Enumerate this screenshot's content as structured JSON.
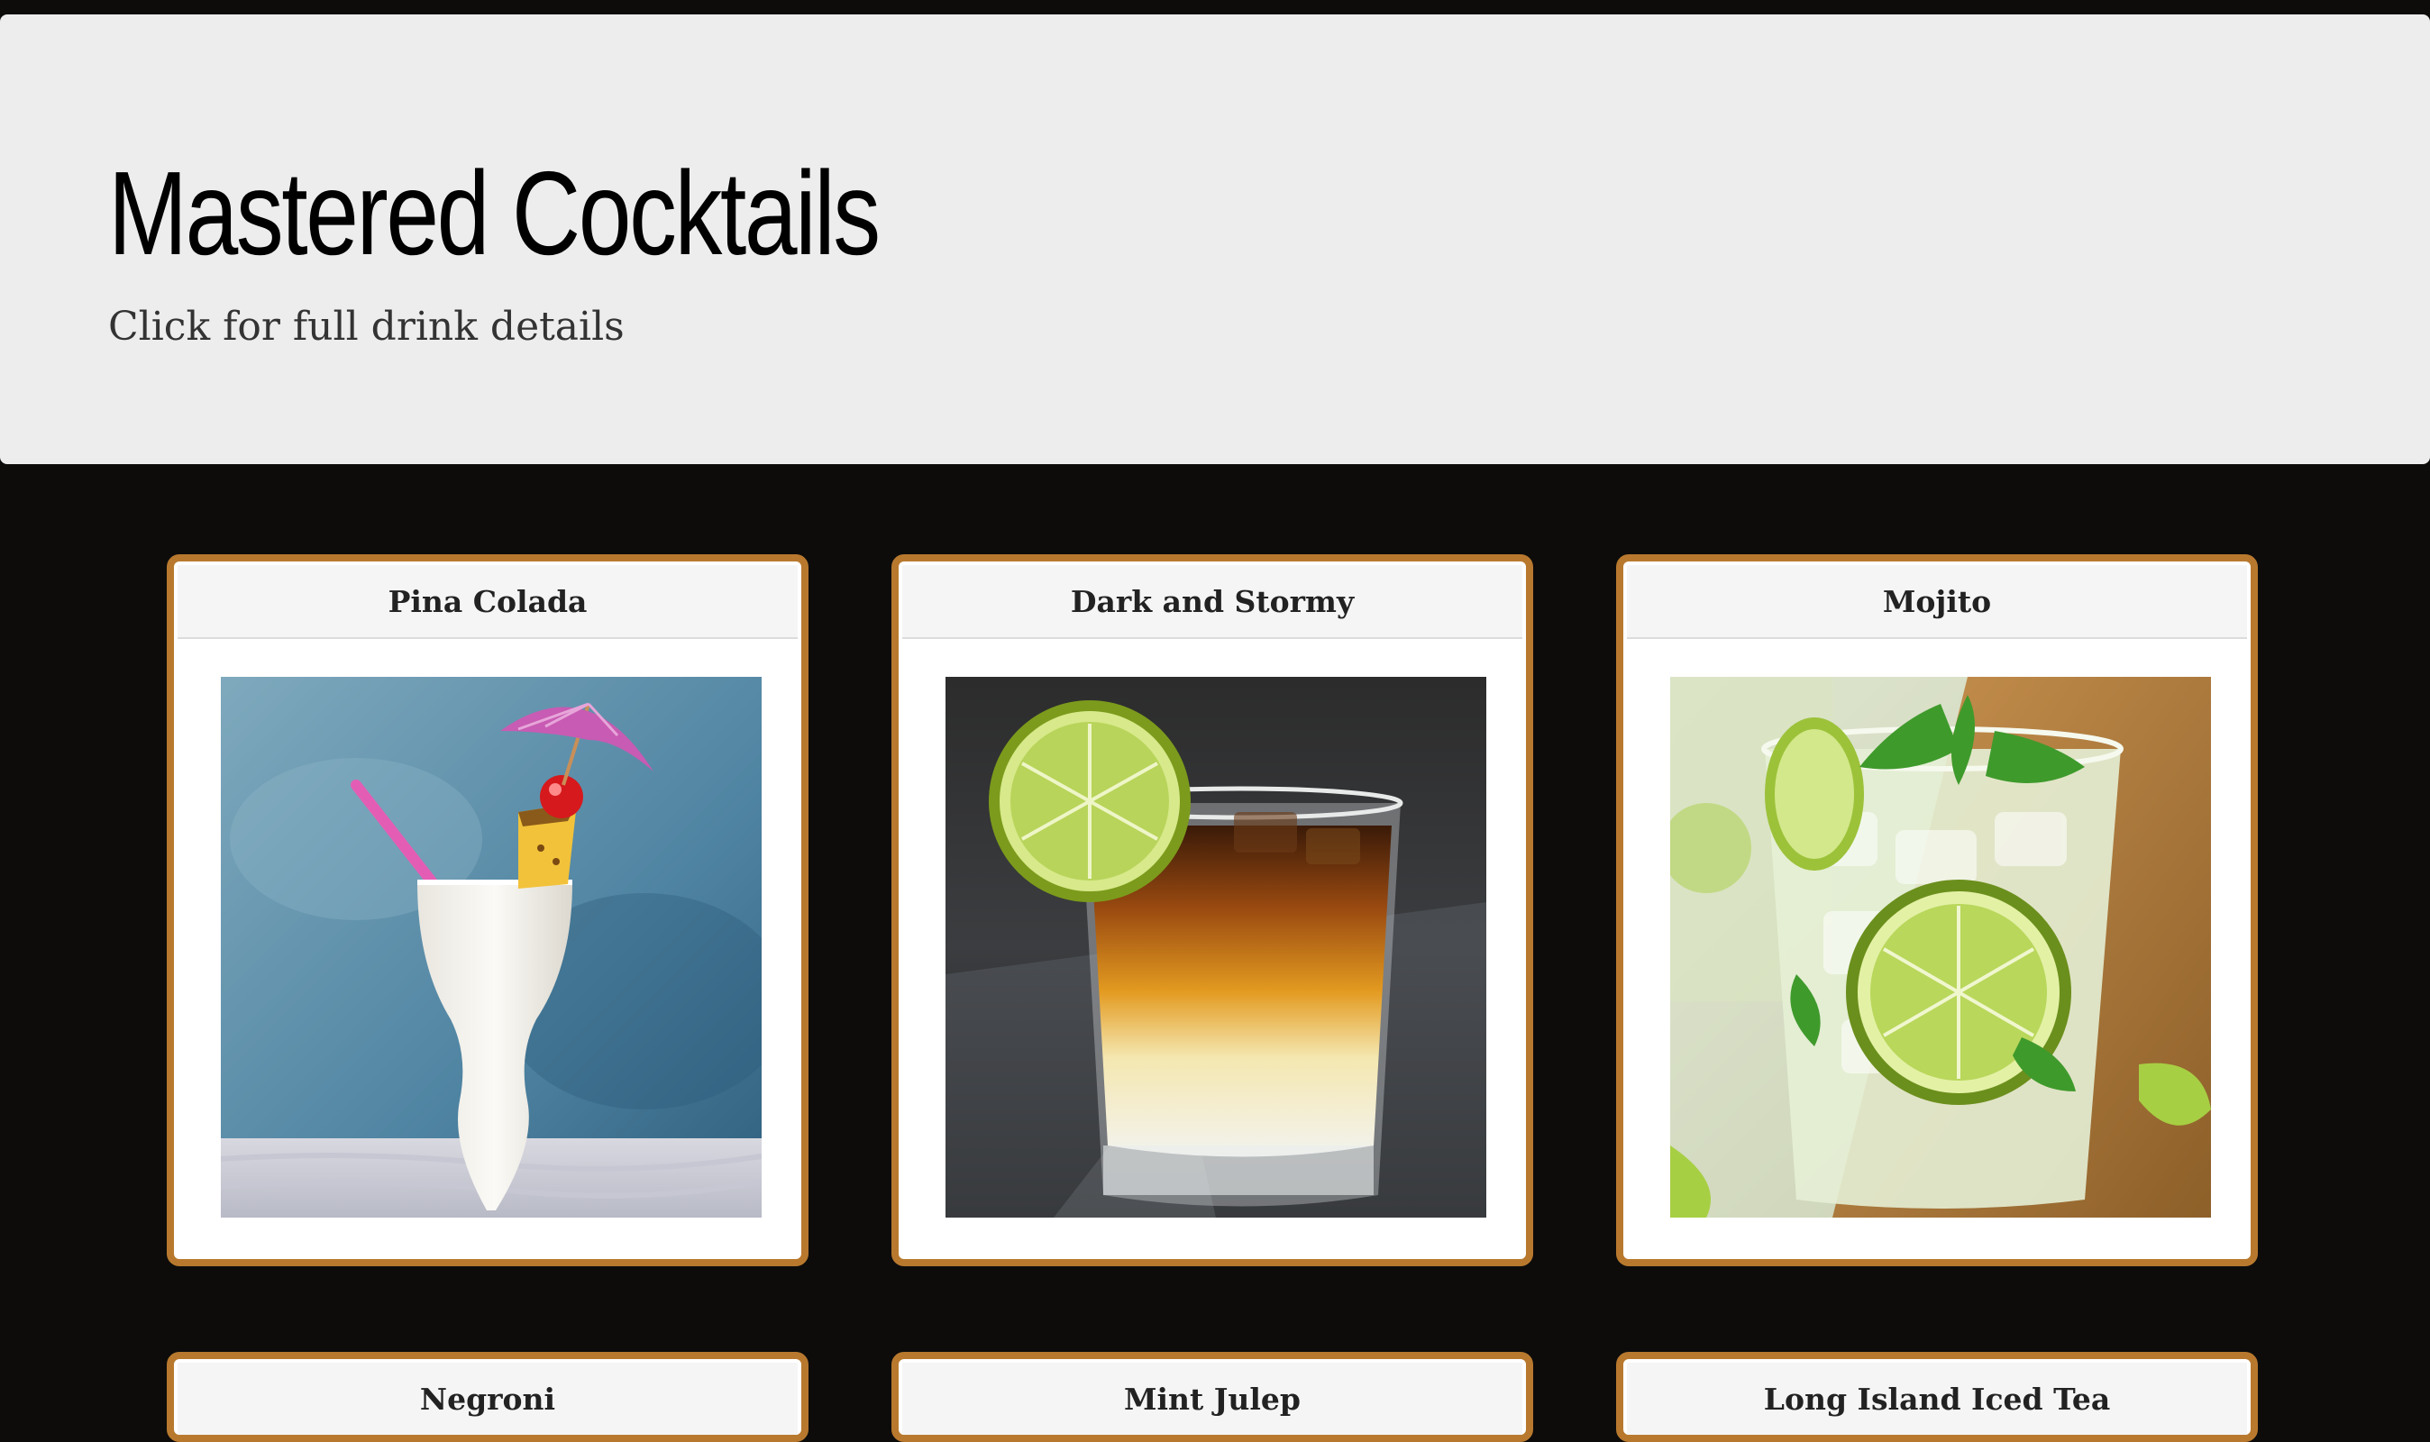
{
  "header": {
    "title": "Mastered Cocktails",
    "subtitle": "Click for full drink details"
  },
  "colors": {
    "page_background": "#0d0c0b",
    "header_background": "#ededed",
    "card_border": "#b8792e",
    "card_header_background": "#f5f5f5"
  },
  "cocktails": [
    {
      "name": "Pina Colada",
      "image": "pina-colada-photo"
    },
    {
      "name": "Dark and Stormy",
      "image": "dark-and-stormy-photo"
    },
    {
      "name": "Mojito",
      "image": "mojito-photo"
    },
    {
      "name": "Negroni"
    },
    {
      "name": "Mint Julep"
    },
    {
      "name": "Long Island Iced Tea"
    }
  ]
}
